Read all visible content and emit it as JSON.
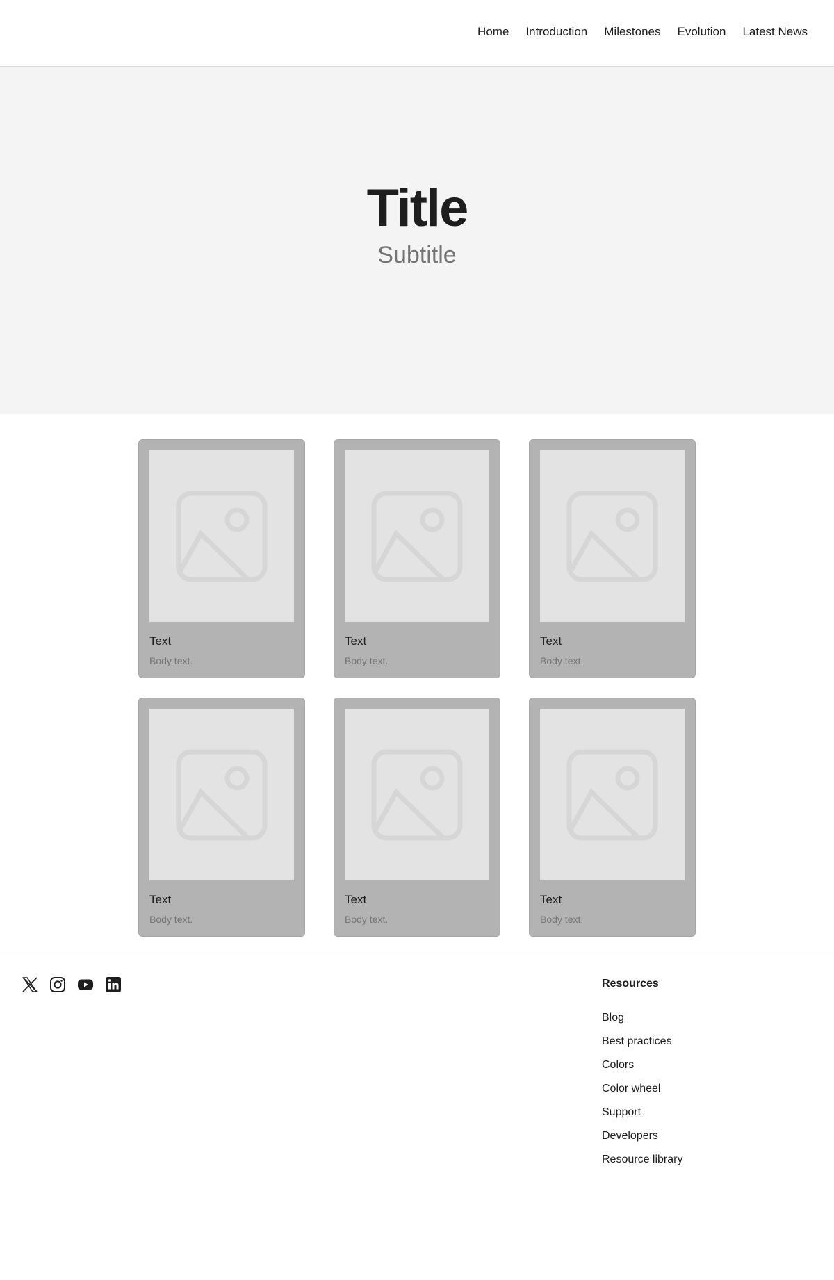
{
  "nav": {
    "items": [
      "Home",
      "Introduction",
      "Milestones",
      "Evolution",
      "Latest News"
    ]
  },
  "hero": {
    "title": "Title",
    "subtitle": "Subtitle"
  },
  "cards": [
    {
      "heading": "Text",
      "body": "Body text.",
      "icon": "image-placeholder-icon"
    },
    {
      "heading": "Text",
      "body": "Body text.",
      "icon": "image-placeholder-icon"
    },
    {
      "heading": "Text",
      "body": "Body text.",
      "icon": "image-placeholder-icon"
    },
    {
      "heading": "Text",
      "body": "Body text.",
      "icon": "image-placeholder-icon"
    },
    {
      "heading": "Text",
      "body": "Body text.",
      "icon": "image-placeholder-icon"
    },
    {
      "heading": "Text",
      "body": "Body text.",
      "icon": "image-placeholder-icon"
    }
  ],
  "footer": {
    "social_icons": [
      "x-icon",
      "instagram-icon",
      "youtube-icon",
      "linkedin-icon"
    ],
    "resources": {
      "heading": "Resources",
      "links": [
        "Blog",
        "Best practices",
        "Colors",
        "Color wheel",
        "Support",
        "Developers",
        "Resource library"
      ]
    }
  },
  "colors": {
    "text": "#1e1e1e",
    "muted": "#757575",
    "hero_bg": "#f4f4f4",
    "card_bg": "#b3b3b3",
    "image_bg": "#e3e3e3",
    "border": "#d9d9d9"
  }
}
